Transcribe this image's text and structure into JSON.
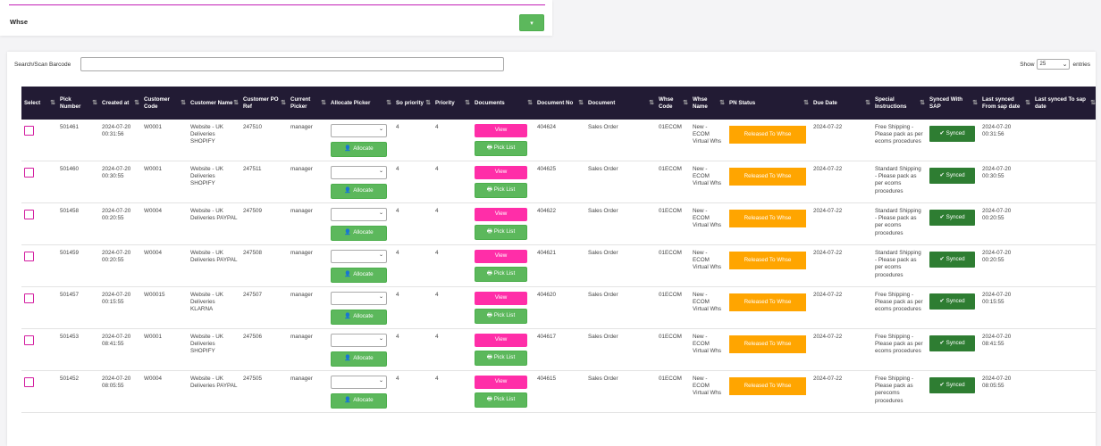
{
  "filter": {
    "title": "Whse",
    "dropdown_glyph": "▾"
  },
  "search": {
    "label": "Search/Scan Barcode",
    "value": ""
  },
  "show": {
    "prefix": "Show",
    "value": "25",
    "suffix": "entries"
  },
  "columns": [
    "Select",
    "Pick Number",
    "Created at",
    "Customer Code",
    "Customer Name",
    "Customer PO Ref",
    "Current Picker",
    "Allocate Picker",
    "So priority",
    "Priority",
    "Documents",
    "Document No",
    "Document",
    "Whse Code",
    "Whse Name",
    "PN Status",
    "Due Date",
    "Special Instructions",
    "Synced With SAP",
    "Last synced From sap date",
    "Last synced To sap date"
  ],
  "labels": {
    "allocate": "Allocate",
    "view": "View",
    "pick_list": "Pick List",
    "status": "Released To Whse",
    "synced": "Synced"
  },
  "icons": {
    "sort": "sort-icon",
    "check": "check-icon",
    "print": "print-icon",
    "user_plus": "user-plus-icon"
  },
  "colors": {
    "header_bg": "#221b34",
    "accent": "#c21fb6",
    "view": "#ff2ea8",
    "green": "#5cb85c",
    "status": "#ffa500",
    "synced": "#2e7d32"
  },
  "rows": [
    {
      "pick": "501461",
      "created": "2024-07-20 00:31:56",
      "cust_code": "W0001",
      "cust_name": "Website - UK Deliveries SHOPIFY",
      "po_ref": "247510",
      "picker": "manager",
      "so_priority": "4",
      "priority": "4",
      "doc_no": "404624",
      "document": "Sales Order",
      "whse_code": "01ECOM",
      "whse_name": "New - ECOM Virtual Whs",
      "due": "2024-07-22",
      "instructions": "Free Shipping - Please pack as per ecoms procedures",
      "last_from": "2024-07-20 00:31:56",
      "last_to": ""
    },
    {
      "pick": "501460",
      "created": "2024-07-20 00:30:55",
      "cust_code": "W0001",
      "cust_name": "Website - UK Deliveries SHOPIFY",
      "po_ref": "247511",
      "picker": "manager",
      "so_priority": "4",
      "priority": "4",
      "doc_no": "404625",
      "document": "Sales Order",
      "whse_code": "01ECOM",
      "whse_name": "New - ECOM Virtual Whs",
      "due": "2024-07-22",
      "instructions": "Standard Shipping - Please pack as per ecoms procedures",
      "last_from": "2024-07-20 00:30:55",
      "last_to": ""
    },
    {
      "pick": "501458",
      "created": "2024-07-20 00:20:55",
      "cust_code": "W0004",
      "cust_name": "Website - UK Deliveries PAYPAL",
      "po_ref": "247509",
      "picker": "manager",
      "so_priority": "4",
      "priority": "4",
      "doc_no": "404622",
      "document": "Sales Order",
      "whse_code": "01ECOM",
      "whse_name": "New - ECOM Virtual Whs",
      "due": "2024-07-22",
      "instructions": "Standard Shipping - Please pack as per ecoms procedures",
      "last_from": "2024-07-20 00:20:55",
      "last_to": ""
    },
    {
      "pick": "501459",
      "created": "2024-07-20 00:20:55",
      "cust_code": "W0004",
      "cust_name": "Website - UK Deliveries PAYPAL",
      "po_ref": "247508",
      "picker": "manager",
      "so_priority": "4",
      "priority": "4",
      "doc_no": "404621",
      "document": "Sales Order",
      "whse_code": "01ECOM",
      "whse_name": "New - ECOM Virtual Whs",
      "due": "2024-07-22",
      "instructions": "Standard Shipping - Please pack as per ecoms procedures",
      "last_from": "2024-07-20 00:20:55",
      "last_to": ""
    },
    {
      "pick": "501457",
      "created": "2024-07-20 00:15:55",
      "cust_code": "W00015",
      "cust_name": "Website - UK Deliveries KLARNA",
      "po_ref": "247507",
      "picker": "manager",
      "so_priority": "4",
      "priority": "4",
      "doc_no": "404620",
      "document": "Sales Order",
      "whse_code": "01ECOM",
      "whse_name": "New - ECOM Virtual Whs",
      "due": "2024-07-22",
      "instructions": "Free Shipping - Please pack as per ecoms procedures",
      "last_from": "2024-07-20 00:15:55",
      "last_to": ""
    },
    {
      "pick": "501453",
      "created": "2024-07-20 08:41:55",
      "cust_code": "W0001",
      "cust_name": "Website - UK Deliveries SHOPIFY",
      "po_ref": "247506",
      "picker": "manager",
      "so_priority": "4",
      "priority": "4",
      "doc_no": "404617",
      "document": "Sales Order",
      "whse_code": "01ECOM",
      "whse_name": "New - ECOM Virtual Whs",
      "due": "2024-07-22",
      "instructions": "Free Shipping - Please pack as per ecoms procedures",
      "last_from": "2024-07-20 08:41:55",
      "last_to": ""
    },
    {
      "pick": "501452",
      "created": "2024-07-20 08:05:55",
      "cust_code": "W0004",
      "cust_name": "Website - UK Deliveries PAYPAL",
      "po_ref": "247505",
      "picker": "manager",
      "so_priority": "4",
      "priority": "4",
      "doc_no": "404615",
      "document": "Sales Order",
      "whse_code": "01ECOM",
      "whse_name": "New - ECOM Virtual Whs",
      "due": "2024-07-22",
      "instructions": "Free Shipping - Please pack as perecoms procedures",
      "last_from": "2024-07-20 08:05:55",
      "last_to": ""
    }
  ]
}
